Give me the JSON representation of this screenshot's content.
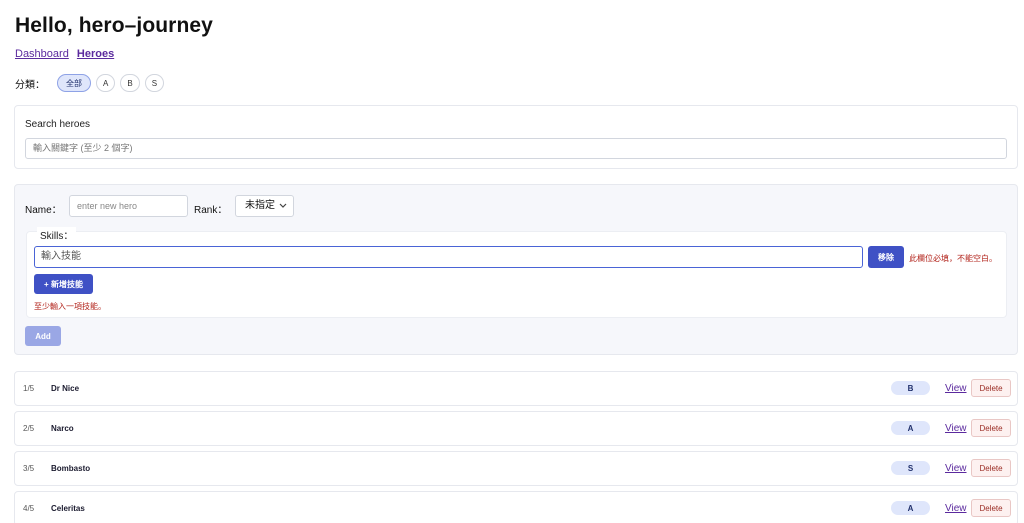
{
  "page": {
    "title": "Hello, hero–journey"
  },
  "nav": {
    "dashboard": "Dashboard",
    "heroes": "Heroes"
  },
  "filter": {
    "label": "分類：",
    "options": [
      "全部",
      "A",
      "B",
      "S"
    ],
    "selected": "全部"
  },
  "search": {
    "title": "Search heroes",
    "placeholder": "輸入關鍵字 (至少 2 個字)"
  },
  "form": {
    "name_label": "Name：",
    "name_placeholder": "enter new hero",
    "rank_label": "Rank：",
    "rank_value": "未指定",
    "skills_label": "Skills：",
    "skill_placeholder": "輸入技能",
    "remove_label": "移除",
    "field_error": "此欄位必填，不能空白。",
    "add_skill_label": "+ 新增技能",
    "min_skill_error": "至少輸入一項技能。",
    "add_label": "Add"
  },
  "heroes": [
    {
      "index": "1/5",
      "name": "Dr Nice",
      "rank": "B",
      "view": "View",
      "delete": "Delete"
    },
    {
      "index": "2/5",
      "name": "Narco",
      "rank": "A",
      "view": "View",
      "delete": "Delete"
    },
    {
      "index": "3/5",
      "name": "Bombasto",
      "rank": "S",
      "view": "View",
      "delete": "Delete"
    },
    {
      "index": "4/5",
      "name": "Celeritas",
      "rank": "A",
      "view": "View",
      "delete": "Delete"
    }
  ],
  "colors": {
    "primary": "#3f51c5",
    "link": "#5b2a9e",
    "error": "#b3261e",
    "badge": "#dfe6fb"
  }
}
